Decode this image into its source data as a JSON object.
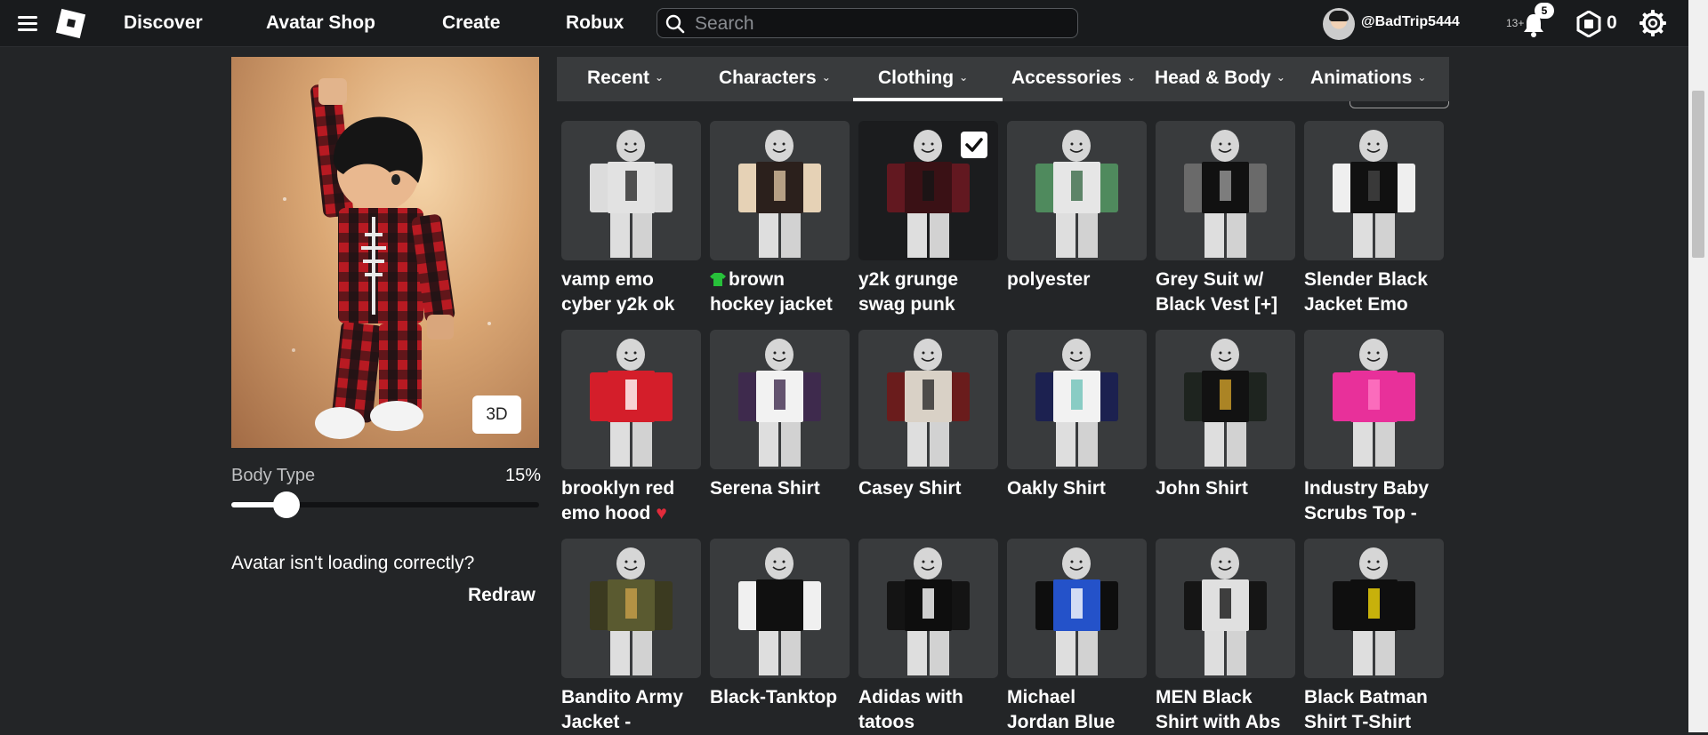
{
  "nav": {
    "links": [
      "Discover",
      "Avatar Shop",
      "Create",
      "Robux"
    ],
    "search_placeholder": "Search",
    "username": "@BadTrip5444",
    "age_label": "13+",
    "notification_count": "5",
    "robux_balance": "0"
  },
  "preview": {
    "btn_3d": "3D",
    "body_type_label": "Body Type",
    "body_type_value": "15%",
    "body_type_fraction": 0.15,
    "loading_text": "Avatar isn't loading correctly?",
    "redraw_label": "Redraw"
  },
  "tabs": [
    {
      "label": "Recent"
    },
    {
      "label": "Characters"
    },
    {
      "label": "Clothing",
      "active": true
    },
    {
      "label": "Accessories"
    },
    {
      "label": "Head & Body"
    },
    {
      "label": "Animations"
    }
  ],
  "items": [
    {
      "name1": "vamp emo",
      "name2": "cyber y2k ok",
      "torso": "#e2e2e2",
      "arms": "#dcdcdc",
      "accent": "#2a2a2a"
    },
    {
      "name1": "brown",
      "name2": "hockey jacket",
      "torso": "#2b201c",
      "arms": "#e6d2b6",
      "accent": "#d9c0a0",
      "badge_icon": "green-shirt-icon"
    },
    {
      "name1": "y2k grunge",
      "name2": "swag punk",
      "torso": "#3a1115",
      "arms": "#621820",
      "accent": "#151515",
      "selected": true
    },
    {
      "name1": "polyester",
      "name2": "",
      "torso": "#e6e6e6",
      "arms": "#4f8a5d",
      "accent": "#3b6b48"
    },
    {
      "name1": "Grey Suit w/",
      "name2": "Black Vest [+]",
      "torso": "#111111",
      "arms": "#6a6a6a",
      "accent": "#999999"
    },
    {
      "name1": "Slender Black",
      "name2": "Jacket Emo",
      "torso": "#111111",
      "arms": "#efefef",
      "accent": "#444444"
    },
    {
      "name1": "brooklyn red",
      "name2": "emo hood",
      "torso": "#d41e2a",
      "arms": "#d41e2a",
      "accent": "#ffffff",
      "emoji": "❤️"
    },
    {
      "name1": "Serena Shirt",
      "name2": "",
      "torso": "#f2f2f2",
      "arms": "#3e2a4d",
      "accent": "#3e2a4d"
    },
    {
      "name1": "Casey Shirt",
      "name2": "",
      "torso": "#d9d1c6",
      "arms": "#6a1c1c",
      "accent": "#2b2b2b"
    },
    {
      "name1": "Oakly Shirt",
      "name2": "",
      "torso": "#f2f2f2",
      "arms": "#1c2150",
      "accent": "#6ec2b8"
    },
    {
      "name1": "John Shirt",
      "name2": "",
      "torso": "#121212",
      "arms": "#1e241f",
      "accent": "#d2a12a"
    },
    {
      "name1": "Industry Baby",
      "name2": "Scrubs Top -",
      "torso": "#e8309a",
      "arms": "#e8309a",
      "accent": "#ff7cc4"
    },
    {
      "name1": "Bandito Army",
      "name2": "Jacket -",
      "torso": "#5a5a30",
      "arms": "#3b3a20",
      "accent": "#c9a04a"
    },
    {
      "name1": "Black-Tanktop",
      "name2": "",
      "torso": "#101010",
      "arms": "#f0f0f0",
      "accent": "#101010"
    },
    {
      "name1": "Adidas with",
      "name2": "tatoos",
      "torso": "#0e0e0e",
      "arms": "#141414",
      "accent": "#ffffff"
    },
    {
      "name1": "Michael",
      "name2": "Jordan Blue",
      "torso": "#2452c9",
      "arms": "#0e0e0e",
      "accent": "#ffffff"
    },
    {
      "name1": "MEN Black",
      "name2": "Shirt with Abs",
      "torso": "#e0e0e0",
      "arms": "#151515",
      "accent": "#151515"
    },
    {
      "name1": "Black Batman",
      "name2": "Shirt T-Shirt",
      "torso": "#0f0f0f",
      "arms": "#0f0f0f",
      "accent": "#f5d90a"
    }
  ]
}
